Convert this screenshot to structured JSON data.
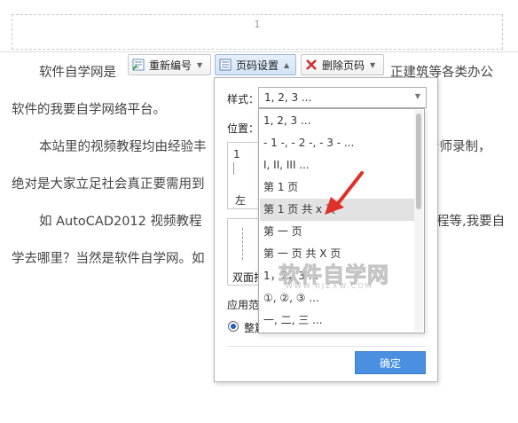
{
  "document": {
    "page_number": "1",
    "paragraphs": [
      "软件自学网是",
      "正建筑等各类办公",
      "软件的我要自学网络平台。",
      "本站里的视频教程均由经验丰",
      "老师录制，",
      "绝对是大家立足社会真正要需用到",
      "如 AutoCAD2012 视频教程",
      "程等,我要自",
      "学去哪里？当然是软件自学网。如"
    ]
  },
  "toolbar": {
    "renumber_label": "重新编号",
    "page_settings_label": "页码设置",
    "delete_label": "删除页码"
  },
  "dialog": {
    "style_label": "样式：",
    "style_value": "1, 2, 3 ...",
    "position_label": "位置：",
    "preview_num": "1",
    "preview_left_label": "左",
    "double_label": "双面打",
    "apply_label": "应用范",
    "radio_label": "整篇",
    "ok_label": "确定"
  },
  "dropdown": {
    "items": [
      "1, 2, 3 ...",
      "- 1 -, - 2 -, - 3 - ...",
      "I, II, III ...",
      "第 1 页",
      "第 1 页 共 x 页",
      "第 一 页",
      "第 一 页 共 X 页",
      "1，2，3 ...",
      "①, ②, ③ ...",
      "一, 二, 三 ..."
    ],
    "highlighted_index": 4
  },
  "watermark": {
    "main": "软件自学网",
    "sub": "WWW.RJZXW.COM"
  },
  "colors": {
    "accent": "#4a8fe0",
    "arrow": "#e0302a"
  }
}
